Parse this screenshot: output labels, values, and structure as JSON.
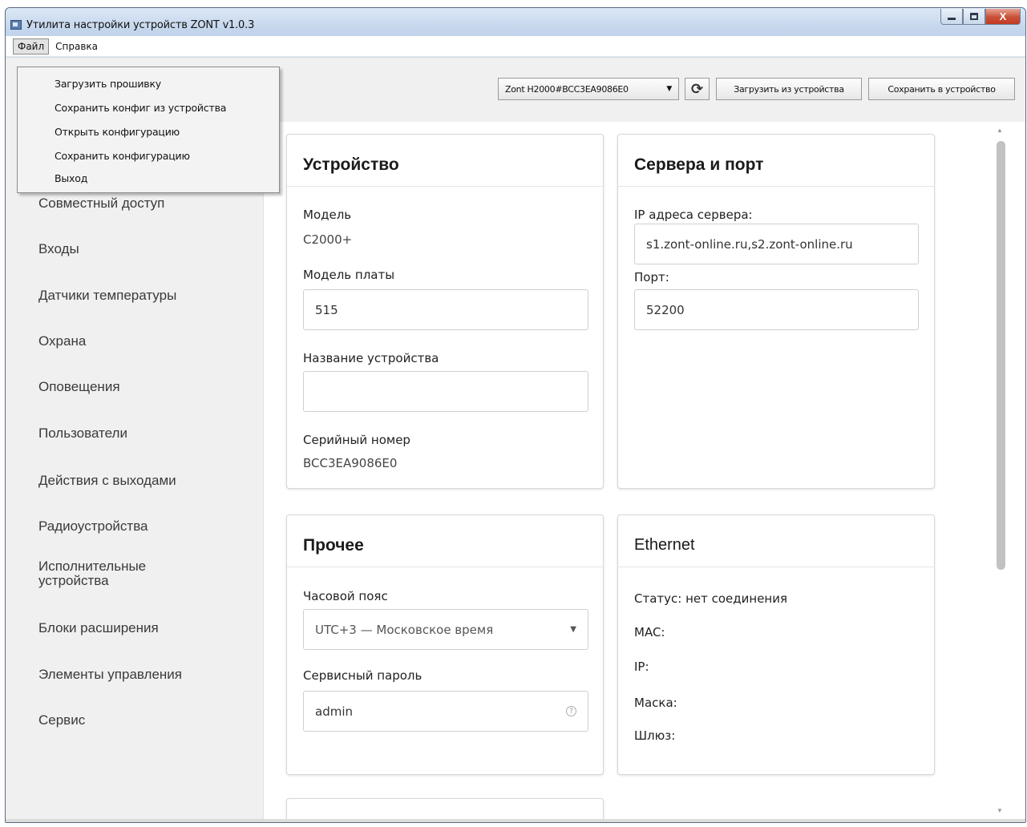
{
  "window": {
    "title": "Утилита настройки устройств ZONT v1.0.3",
    "controls": {
      "minimize": "",
      "maximize": "",
      "close": "X"
    }
  },
  "menubar": {
    "items": [
      "Файл",
      "Справка"
    ]
  },
  "file_menu": {
    "items": [
      "Загрузить прошивку",
      "Сохранить конфиг из устройства",
      "Открыть конфигурацию",
      "Сохранить конфигурацию",
      "Выход"
    ]
  },
  "toolbar": {
    "device_select": "Zont H2000#BCC3EA9086E0",
    "refresh_icon": "refresh-icon",
    "load_from_device": "Загрузить из устройства",
    "save_to_device": "Сохранить в устройство"
  },
  "sidebar": {
    "items": [
      "Совместный доступ",
      "Входы",
      "Датчики температуры",
      "Охрана",
      "Оповещения",
      "Пользователи",
      "Действия с выходами",
      "Радиоустройства",
      "Исполнительные\nустройства",
      "Блоки расширения",
      "Элементы управления",
      "Сервис"
    ]
  },
  "device_card": {
    "title": "Устройство",
    "model_label": "Модель",
    "model_value": "C2000+",
    "board_label": "Модель платы",
    "board_value": "515",
    "name_label": "Название устройства",
    "name_value": "",
    "serial_label": "Серийный номер",
    "serial_value": "BCC3EA9086E0"
  },
  "servers_card": {
    "title": "Сервера и порт",
    "ip_label": "IP адреса сервера:",
    "ip_value": "s1.zont-online.ru,s2.zont-online.ru",
    "port_label": "Порт:",
    "port_value": "52200"
  },
  "other_card": {
    "title": "Прочее",
    "tz_label": "Часовой пояс",
    "tz_value": "UTC+3 — Московское время",
    "pass_label": "Сервисный пароль",
    "pass_value": "admin"
  },
  "ethernet_card": {
    "title": "Ethernet",
    "status": "Статус: нет соединения",
    "mac": "MAC:",
    "ip": "IP:",
    "mask": "Маска:",
    "gateway": "Шлюз:"
  }
}
